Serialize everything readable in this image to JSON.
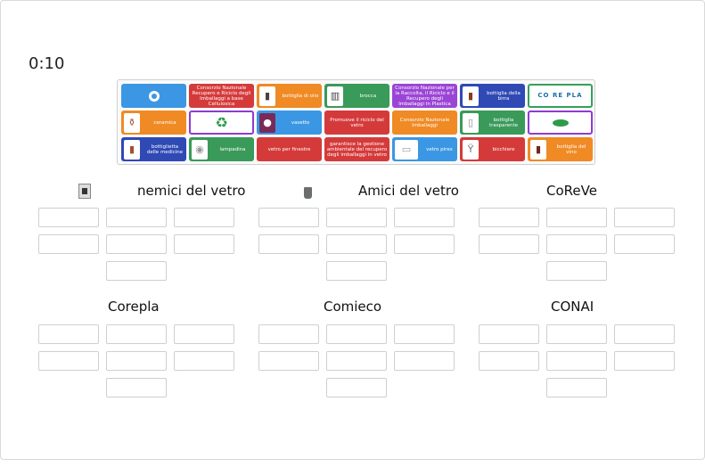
{
  "timer": "0:10",
  "tray": {
    "tiles": [
      {
        "label": "",
        "color": "#3b97e3",
        "icon": "logo-icon"
      },
      {
        "label": "Consorzio Nazionale Recupero e Riciclo degli Imballaggi a base Cellulosica",
        "color": "#d53a3a"
      },
      {
        "label": "bottiglia di olio",
        "color": "#f08a24",
        "icon": "oil-bottle-icon"
      },
      {
        "label": "brocca",
        "color": "#3a9a5a",
        "icon": "jug-icon"
      },
      {
        "label": "Consorzio Nazionale per la Raccolta, il Riciclo e il Recupero degli Imballaggi in Plastica",
        "color": "#9b45d6"
      },
      {
        "label": "bottiglia della birra",
        "color": "#2f49b5",
        "icon": "beer-bottle-icon"
      },
      {
        "label": "COREPLA",
        "color": "#ffffff",
        "icon": "corepla-logo-icon"
      },
      {
        "label": "ceramica",
        "color": "#f08a24",
        "icon": "ceramic-icon"
      },
      {
        "label": "",
        "color": "#ffffff",
        "icon": "recycle-icon"
      },
      {
        "label": "vasetto",
        "color": "#3b97e3",
        "icon": "jar-icon"
      },
      {
        "label": "Promuove il riciclo del vetro",
        "color": "#d53a3a"
      },
      {
        "label": "Consorzio Nazionale Imballaggi",
        "color": "#f08a24"
      },
      {
        "label": "bottiglia trasparente",
        "color": "#3a9a5a",
        "icon": "clear-bottle-icon"
      },
      {
        "label": "",
        "color": "#ffffff",
        "icon": "comieco-logo-icon"
      },
      {
        "label": "bottiglietta delle medicine",
        "color": "#2f49b5",
        "icon": "medicine-bottle-icon"
      },
      {
        "label": "lampadina",
        "color": "#3a9a5a",
        "icon": "bulb-icon"
      },
      {
        "label": "vetro per finestre",
        "color": "#d53a3a"
      },
      {
        "label": "garantisce la gestione ambientale del recupero degli imballaggi in vetro",
        "color": "#d53a3a"
      },
      {
        "label": "vetro pirex",
        "color": "#3b97e3",
        "icon": "pyrex-icon"
      },
      {
        "label": "bicchiere",
        "color": "#d53a3a",
        "icon": "glass-icon"
      },
      {
        "label": "bottiglia del vino",
        "color": "#f08a24",
        "icon": "wine-bottle-icon"
      }
    ]
  },
  "groups": [
    {
      "title": "nemici del vetro",
      "icon": "bin-icon"
    },
    {
      "title": "Amici del vetro",
      "icon": "bin-icon"
    },
    {
      "title": "CoReVe"
    },
    {
      "title": "Corepla"
    },
    {
      "title": "Comieco"
    },
    {
      "title": "CONAI"
    }
  ]
}
